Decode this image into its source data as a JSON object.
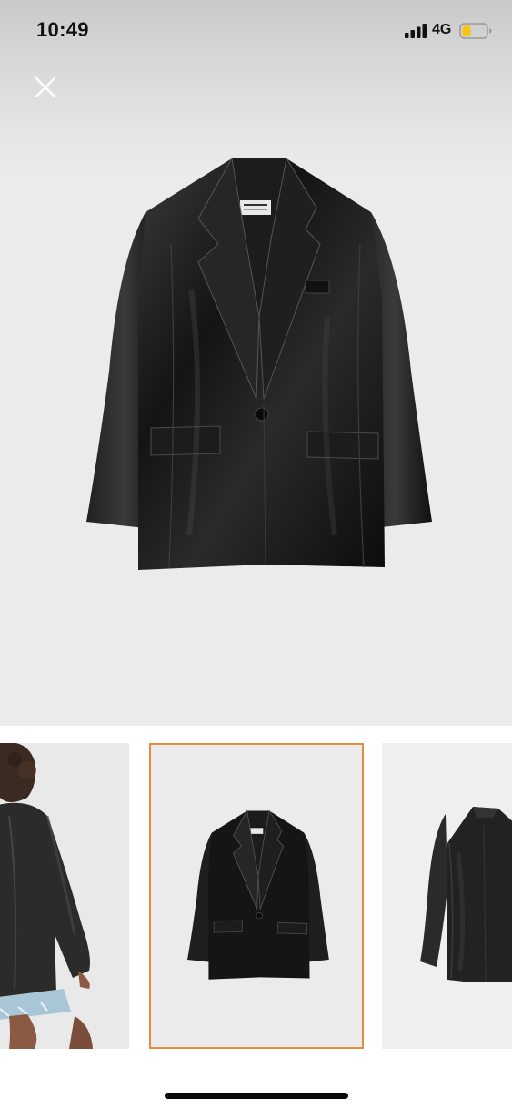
{
  "status_bar": {
    "time": "10:49",
    "network": "4G",
    "signal_icon": "cellular-signal-icon",
    "battery_icon": "battery-icon",
    "battery_level": 0.3,
    "battery_color": "#f5c518"
  },
  "viewer": {
    "close_icon": "close-icon",
    "main_image": "black-leather-blazer-front-photo",
    "background_color": "#ebebeb"
  },
  "gallery": {
    "thumbnails": [
      {
        "image": "model-wearing-blazer-back-view",
        "selected": false
      },
      {
        "image": "black-leather-blazer-front-photo",
        "selected": true
      },
      {
        "image": "black-leather-blazer-back-photo",
        "selected": false
      }
    ],
    "selected_border_color": "#e48b3c"
  }
}
